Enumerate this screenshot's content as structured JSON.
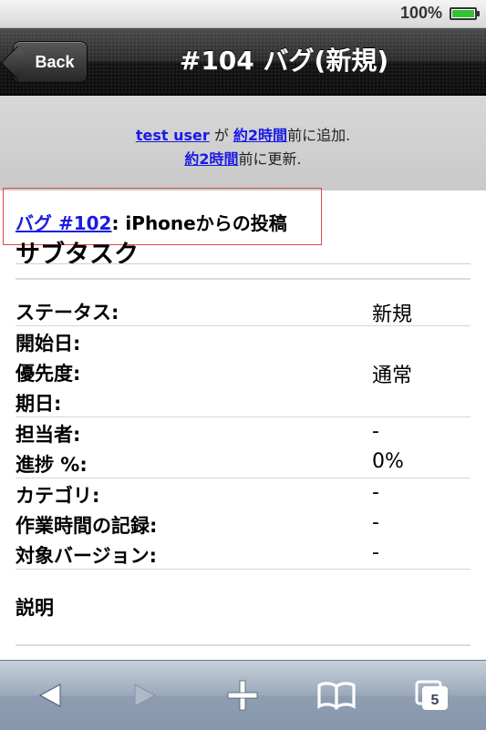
{
  "status_bar": {
    "battery_text": "100%"
  },
  "nav": {
    "back_label": "Back",
    "title": "#104 バグ(新規)"
  },
  "meta": {
    "author": "test user",
    "ga": " が ",
    "added_time": "約2時間",
    "added_suffix": "前に追加.",
    "updated_time": "約2時間",
    "updated_suffix": "前に更新."
  },
  "parent": {
    "link": "バグ #102",
    "rest": ": iPhoneからの投稿"
  },
  "subtask_title": "サブタスク",
  "attributes": [
    {
      "label": "ステータス:",
      "value": "新規"
    },
    {
      "label": "開始日:",
      "value": ""
    },
    {
      "label": "優先度:",
      "value": "通常"
    },
    {
      "label": "期日:",
      "value": ""
    },
    {
      "label": "担当者:",
      "value": "-"
    },
    {
      "label": "進捗 %:",
      "value": "0%"
    },
    {
      "label": "カテゴリ:",
      "value": "-"
    },
    {
      "label": "作業時間の記録:",
      "value": "-"
    },
    {
      "label": "対象バージョン:",
      "value": "-"
    }
  ],
  "description_label": "説明",
  "toolbar": {
    "tabs_count": "5"
  },
  "icons": [
    "battery-icon",
    "back-arrow-icon",
    "forward-arrow-icon",
    "add-icon",
    "bookmarks-icon",
    "tabs-icon"
  ]
}
